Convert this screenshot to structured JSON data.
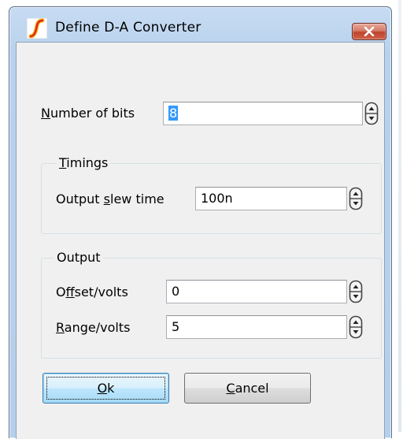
{
  "window": {
    "title": "Define D-A Converter",
    "app_icon": "simetrix-logo-icon",
    "close_icon": "close-icon"
  },
  "fields": {
    "number_of_bits": {
      "label_accel": "N",
      "label_rest": "umber of bits",
      "value": "8"
    }
  },
  "timings": {
    "title_accel": "T",
    "title_rest": "imings",
    "output_slew": {
      "label_pre": "Output ",
      "label_accel": "s",
      "label_rest": "lew time",
      "value": "100n"
    }
  },
  "output": {
    "title": "Output",
    "offset": {
      "label_pre": "O",
      "label_accel": "f",
      "label_rest": "fset/volts",
      "value": "0"
    },
    "range": {
      "label_accel": "R",
      "label_rest": "ange/volts",
      "value": "5"
    }
  },
  "buttons": {
    "ok_accel": "O",
    "ok_rest": "k",
    "cancel_accel": "C",
    "cancel_rest": "ancel"
  },
  "colors": {
    "selection": "#3399ff",
    "close_button": "#c7442e",
    "logo": "#e8a317"
  }
}
